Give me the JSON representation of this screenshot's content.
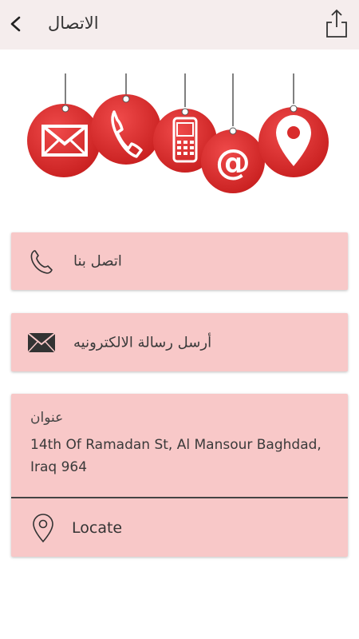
{
  "header": {
    "title": "الاتصال",
    "back_icon": "chevron-left-icon",
    "share_icon": "share-icon"
  },
  "hero": {
    "tags": [
      "mail-tag-icon",
      "phone-tag-icon",
      "mobile-tag-icon",
      "at-tag-icon",
      "location-tag-icon"
    ],
    "tag_color": "#d92b2b"
  },
  "actions": {
    "call_label": "اتصل بنا",
    "email_label": "أرسل رسالة الالكترونيه"
  },
  "address": {
    "label": "عنوان",
    "text": "14th Of Ramadan St, Al Mansour Baghdad, Iraq 964",
    "locate_label": "Locate"
  },
  "colors": {
    "card_bg": "#f8c8c8",
    "header_bg": "#f5eded",
    "accent_red": "#d92b2b"
  }
}
